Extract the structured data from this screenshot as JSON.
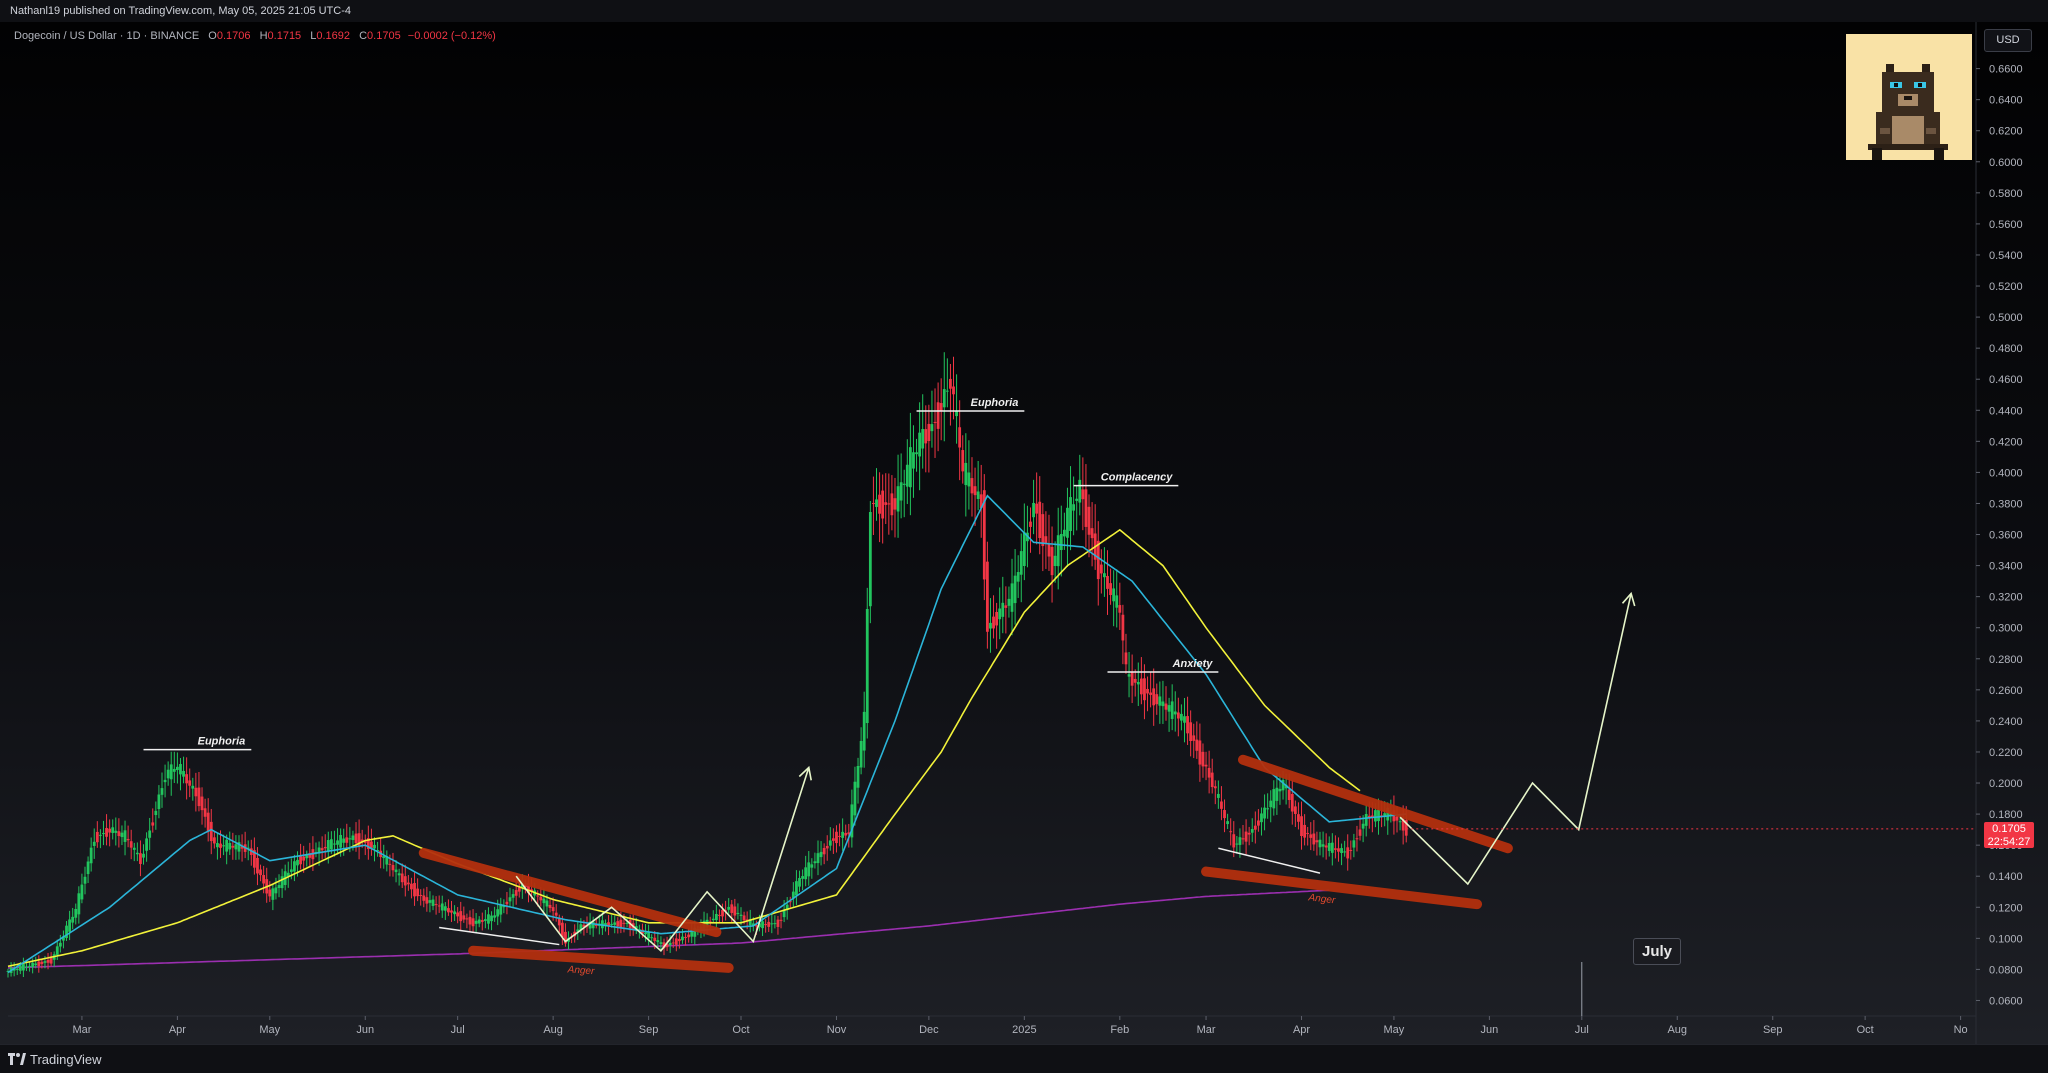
{
  "header": {
    "publisher_line": "Nathanl19 published on TradingView.com, May 05, 2025 21:05 UTC-4"
  },
  "legend": {
    "symbol": "Dogecoin / US Dollar · 1D · BINANCE",
    "open_label": "O",
    "open": "0.1706",
    "high_label": "H",
    "high": "0.1715",
    "low_label": "L",
    "low": "0.1692",
    "close_label": "C",
    "close": "0.1705",
    "change": "−0.0002 (−0.12%)"
  },
  "price_axis": {
    "currency": "USD",
    "current_price": "0.1705",
    "countdown": "22:54:27"
  },
  "footer": {
    "brand": "TradingView"
  },
  "colors": {
    "up": "#22c55e",
    "down": "#f23645",
    "ema_fast": "#2bb5d9",
    "ema_slow": "#f2f23a",
    "ema_long": "#9b2fb0",
    "annotation_band": "#b3300e",
    "projection": "#e6f5c9"
  },
  "avatar": {
    "icon": "pixel-cat-avatar"
  },
  "chart_data": {
    "type": "candlestick",
    "symbol": "Dogecoin / US Dollar",
    "timeframe": "1D",
    "exchange": "BINANCE",
    "y_scale": "linear",
    "ylim": [
      0.05,
      0.69
    ],
    "xlim": [
      "2024-02-06",
      "2025-11-06"
    ],
    "y_ticks": [
      "0.0600",
      "0.0800",
      "0.1000",
      "0.1200",
      "0.1400",
      "0.1600",
      "0.1800",
      "0.2000",
      "0.2200",
      "0.2400",
      "0.2600",
      "0.2800",
      "0.3000",
      "0.3200",
      "0.3400",
      "0.3600",
      "0.3800",
      "0.4000",
      "0.4200",
      "0.4400",
      "0.4600",
      "0.4800",
      "0.5000",
      "0.5200",
      "0.5400",
      "0.5600",
      "0.5800",
      "0.6000",
      "0.6200",
      "0.6400",
      "0.6600"
    ],
    "x_ticks": [
      {
        "label": "Mar",
        "date": "2024-03-01"
      },
      {
        "label": "Apr",
        "date": "2024-04-01"
      },
      {
        "label": "May",
        "date": "2024-05-01"
      },
      {
        "label": "Jun",
        "date": "2024-06-01"
      },
      {
        "label": "Jul",
        "date": "2024-07-01"
      },
      {
        "label": "Aug",
        "date": "2024-08-01"
      },
      {
        "label": "Sep",
        "date": "2024-09-01"
      },
      {
        "label": "Oct",
        "date": "2024-10-01"
      },
      {
        "label": "Nov",
        "date": "2024-11-01"
      },
      {
        "label": "Dec",
        "date": "2024-12-01"
      },
      {
        "label": "2025",
        "date": "2025-01-01"
      },
      {
        "label": "Feb",
        "date": "2025-02-01"
      },
      {
        "label": "Mar",
        "date": "2025-03-01"
      },
      {
        "label": "Apr",
        "date": "2025-04-01"
      },
      {
        "label": "May",
        "date": "2025-05-01"
      },
      {
        "label": "Jun",
        "date": "2025-06-01"
      },
      {
        "label": "Jul",
        "date": "2025-07-01"
      },
      {
        "label": "Aug",
        "date": "2025-08-01"
      },
      {
        "label": "Sep",
        "date": "2025-09-01"
      },
      {
        "label": "Oct",
        "date": "2025-10-01"
      },
      {
        "label": "No",
        "date": "2025-11-01"
      }
    ],
    "series": [
      {
        "id": "price",
        "kind": "candles",
        "anchors": [
          [
            "2024-02-06",
            0.079
          ],
          [
            "2024-02-20",
            0.086
          ],
          [
            "2024-02-28",
            0.118
          ],
          [
            "2024-03-05",
            0.165
          ],
          [
            "2024-03-10",
            0.17
          ],
          [
            "2024-03-15",
            0.165
          ],
          [
            "2024-03-20",
            0.15
          ],
          [
            "2024-03-28",
            0.205
          ],
          [
            "2024-04-01",
            0.21
          ],
          [
            "2024-04-08",
            0.19
          ],
          [
            "2024-04-13",
            0.16
          ],
          [
            "2024-04-24",
            0.158
          ],
          [
            "2024-05-01",
            0.127
          ],
          [
            "2024-05-10",
            0.15
          ],
          [
            "2024-05-20",
            0.16
          ],
          [
            "2024-05-28",
            0.165
          ],
          [
            "2024-06-03",
            0.16
          ],
          [
            "2024-06-12",
            0.14
          ],
          [
            "2024-06-20",
            0.125
          ],
          [
            "2024-07-01",
            0.115
          ],
          [
            "2024-07-06",
            0.11
          ],
          [
            "2024-07-12",
            0.113
          ],
          [
            "2024-07-22",
            0.135
          ],
          [
            "2024-08-01",
            0.118
          ],
          [
            "2024-08-05",
            0.098
          ],
          [
            "2024-08-10",
            0.108
          ],
          [
            "2024-08-25",
            0.11
          ],
          [
            "2024-09-06",
            0.095
          ],
          [
            "2024-09-15",
            0.103
          ],
          [
            "2024-09-27",
            0.12
          ],
          [
            "2024-10-05",
            0.108
          ],
          [
            "2024-10-13",
            0.11
          ],
          [
            "2024-10-20",
            0.138
          ],
          [
            "2024-10-31",
            0.165
          ],
          [
            "2024-11-05",
            0.168
          ],
          [
            "2024-11-10",
            0.24
          ],
          [
            "2024-11-12",
            0.38
          ],
          [
            "2024-11-14",
            0.38
          ],
          [
            "2024-11-20",
            0.38
          ],
          [
            "2024-11-28",
            0.42
          ],
          [
            "2024-12-02",
            0.43
          ],
          [
            "2024-12-08",
            0.46
          ],
          [
            "2024-12-12",
            0.4
          ],
          [
            "2024-12-18",
            0.38
          ],
          [
            "2024-12-20",
            0.3
          ],
          [
            "2024-12-28",
            0.32
          ],
          [
            "2025-01-04",
            0.38
          ],
          [
            "2025-01-10",
            0.34
          ],
          [
            "2025-01-15",
            0.37
          ],
          [
            "2025-01-19",
            0.39
          ],
          [
            "2025-01-25",
            0.34
          ],
          [
            "2025-02-01",
            0.31
          ],
          [
            "2025-02-03",
            0.27
          ],
          [
            "2025-02-15",
            0.25
          ],
          [
            "2025-02-22",
            0.24
          ],
          [
            "2025-03-03",
            0.2
          ],
          [
            "2025-03-10",
            0.16
          ],
          [
            "2025-03-16",
            0.17
          ],
          [
            "2025-03-26",
            0.2
          ],
          [
            "2025-04-01",
            0.17
          ],
          [
            "2025-04-07",
            0.16
          ],
          [
            "2025-04-16",
            0.155
          ],
          [
            "2025-04-22",
            0.178
          ],
          [
            "2025-04-30",
            0.18
          ],
          [
            "2025-05-05",
            0.1705
          ]
        ]
      },
      {
        "id": "ema_fast",
        "kind": "line",
        "color": "#2bb5d9",
        "anchors": [
          [
            "2024-02-06",
            0.078
          ],
          [
            "2024-03-10",
            0.12
          ],
          [
            "2024-04-05",
            0.163
          ],
          [
            "2024-04-12",
            0.17
          ],
          [
            "2024-05-01",
            0.15
          ],
          [
            "2024-06-01",
            0.16
          ],
          [
            "2024-07-01",
            0.128
          ],
          [
            "2024-08-05",
            0.112
          ],
          [
            "2024-09-05",
            0.103
          ],
          [
            "2024-10-05",
            0.108
          ],
          [
            "2024-11-01",
            0.145
          ],
          [
            "2024-11-20",
            0.24
          ],
          [
            "2024-12-05",
            0.325
          ],
          [
            "2024-12-20",
            0.385
          ],
          [
            "2025-01-04",
            0.355
          ],
          [
            "2025-01-20",
            0.352
          ],
          [
            "2025-02-05",
            0.33
          ],
          [
            "2025-03-01",
            0.27
          ],
          [
            "2025-03-20",
            0.21
          ],
          [
            "2025-04-10",
            0.175
          ],
          [
            "2025-05-05",
            0.18
          ]
        ]
      },
      {
        "id": "ema_slow",
        "kind": "line",
        "color": "#f2f23a",
        "anchors": [
          [
            "2024-02-06",
            0.082
          ],
          [
            "2024-03-01",
            0.092
          ],
          [
            "2024-04-01",
            0.11
          ],
          [
            "2024-05-01",
            0.134
          ],
          [
            "2024-06-01",
            0.163
          ],
          [
            "2024-06-10",
            0.166
          ],
          [
            "2024-07-01",
            0.148
          ],
          [
            "2024-08-01",
            0.125
          ],
          [
            "2024-09-01",
            0.11
          ],
          [
            "2024-10-01",
            0.11
          ],
          [
            "2024-11-01",
            0.128
          ],
          [
            "2024-11-20",
            0.18
          ],
          [
            "2024-12-05",
            0.22
          ],
          [
            "2024-12-15",
            0.255
          ],
          [
            "2025-01-01",
            0.31
          ],
          [
            "2025-01-15",
            0.34
          ],
          [
            "2025-02-01",
            0.363
          ],
          [
            "2025-02-15",
            0.34
          ],
          [
            "2025-03-01",
            0.3
          ],
          [
            "2025-03-20",
            0.25
          ],
          [
            "2025-04-10",
            0.21
          ],
          [
            "2025-04-20",
            0.195
          ]
        ]
      },
      {
        "id": "ema_long",
        "kind": "line",
        "color": "#9b2fb0",
        "anchors": [
          [
            "2024-02-06",
            0.081
          ],
          [
            "2024-07-01",
            0.09
          ],
          [
            "2024-10-01",
            0.097
          ],
          [
            "2024-12-01",
            0.108
          ],
          [
            "2025-02-01",
            0.122
          ],
          [
            "2025-03-01",
            0.127
          ],
          [
            "2025-04-10",
            0.131
          ]
        ]
      }
    ],
    "annotations": [
      {
        "kind": "hline",
        "label": "Euphoria",
        "from": "2024-03-21",
        "to": "2024-04-25",
        "y": 0.2215
      },
      {
        "kind": "hline",
        "label": "Euphoria",
        "from": "2024-11-27",
        "to": "2025-01-01",
        "y": 0.4395
      },
      {
        "kind": "hline",
        "label": "Complacency",
        "from": "2025-01-17",
        "to": "2025-02-20",
        "y": 0.3915
      },
      {
        "kind": "hline",
        "label": "Anxiety",
        "from": "2025-01-28",
        "to": "2025-03-05",
        "y": 0.2715
      },
      {
        "kind": "band",
        "label": "Anger",
        "from": [
          "2024-07-06",
          0.092
        ],
        "to": [
          "2024-09-27",
          0.081
        ]
      },
      {
        "kind": "band",
        "label": "Anger",
        "from": [
          "2025-03-01",
          0.143
        ],
        "to": [
          "2025-05-28",
          0.122
        ]
      },
      {
        "kind": "band",
        "label": "",
        "from": [
          "2024-06-20",
          0.155
        ],
        "to": [
          "2024-09-23",
          0.104
        ]
      },
      {
        "kind": "band",
        "label": "",
        "from": [
          "2025-03-13",
          0.215
        ],
        "to": [
          "2025-06-07",
          0.158
        ]
      },
      {
        "kind": "trendline",
        "from": [
          "2024-06-25",
          0.107
        ],
        "to": [
          "2024-08-03",
          0.096
        ]
      },
      {
        "kind": "trendline",
        "from": [
          "2025-03-05",
          0.158
        ],
        "to": [
          "2025-04-07",
          0.142
        ]
      },
      {
        "kind": "path",
        "label": "",
        "points": [
          [
            "2024-07-20",
            0.14
          ],
          [
            "2024-08-05",
            0.098
          ],
          [
            "2024-08-20",
            0.12
          ],
          [
            "2024-09-05",
            0.092
          ],
          [
            "2024-09-20",
            0.13
          ],
          [
            "2024-10-05",
            0.098
          ],
          [
            "2024-10-23",
            0.21
          ]
        ]
      },
      {
        "kind": "path",
        "label": "",
        "points": [
          [
            "2025-05-03",
            0.178
          ],
          [
            "2025-05-25",
            0.135
          ],
          [
            "2025-06-15",
            0.2
          ],
          [
            "2025-06-30",
            0.17
          ],
          [
            "2025-07-17",
            0.322
          ]
        ]
      },
      {
        "kind": "vline_label",
        "label": "July",
        "date": "2025-07-01"
      }
    ]
  }
}
